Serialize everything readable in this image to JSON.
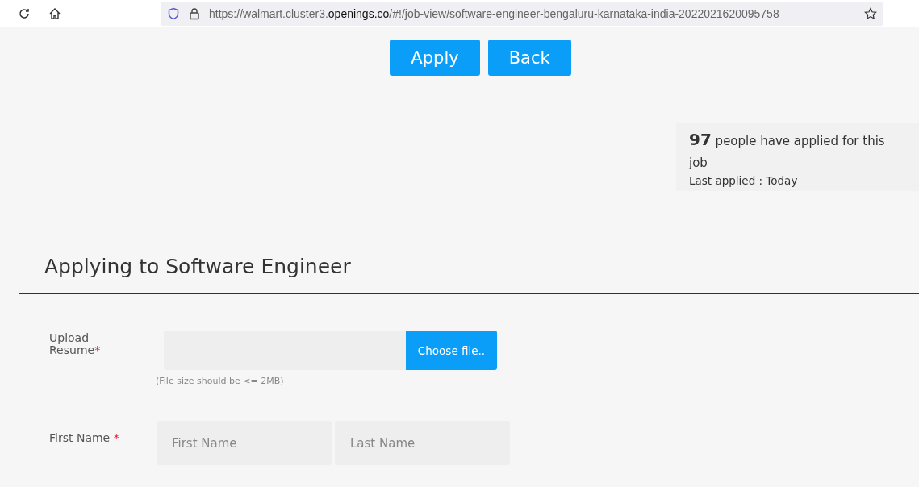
{
  "browser": {
    "url_prefix": "https://walmart.cluster3.",
    "url_domain": "openings.co",
    "url_path": "/#!/job-view/software-engineer-bengaluru-karnataka-india-2022021620095758"
  },
  "actions": [
    "Apply",
    "Back"
  ],
  "stats": {
    "count": "97",
    "text": "people have applied for this job",
    "last_applied": "Last applied : Today"
  },
  "heading": "Applying to Software Engineer",
  "form": {
    "resume": {
      "label": "Upload Resume",
      "required_mark": "*",
      "button": "Choose file..",
      "hint": "(File size should be <= 2MB)"
    },
    "name": {
      "label": "First Name",
      "required_mark": "*",
      "first_placeholder": "First Name",
      "last_placeholder": "Last Name"
    }
  }
}
